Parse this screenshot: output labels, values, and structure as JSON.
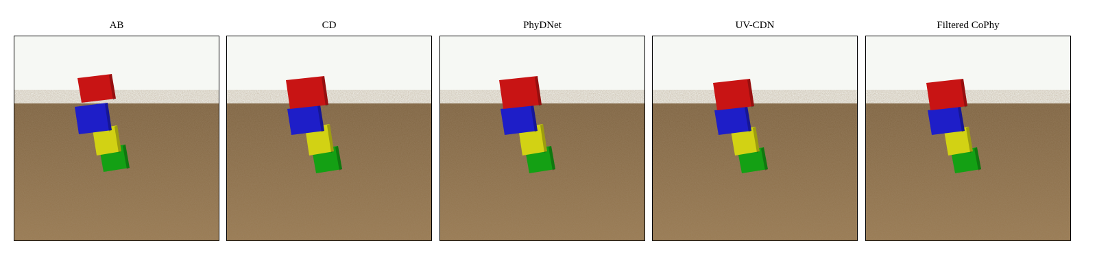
{
  "figure": {
    "panels": [
      {
        "title": "AB"
      },
      {
        "title": "CD"
      },
      {
        "title": "PhyDNet"
      },
      {
        "title": "UV-CDN"
      },
      {
        "title": "Filtered CoPhy"
      }
    ]
  },
  "colors": {
    "sky": "#f6f8f4",
    "ground": "#8c6e48",
    "cube_red": "#c81414",
    "cube_blue": "#1e1ec8",
    "cube_yellow": "#d2d214",
    "cube_green": "#14a014"
  }
}
